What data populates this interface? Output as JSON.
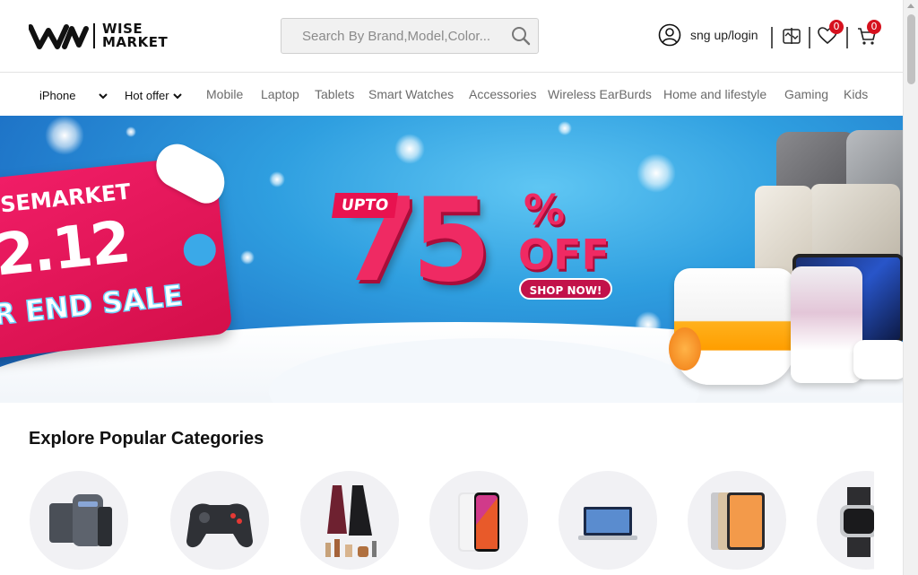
{
  "header": {
    "logo_text_line1": "WISE",
    "logo_text_line2": "MARKET",
    "search_placeholder": "Search By Brand,Model,Color...",
    "login_label": "sng up/login",
    "wishlist_count": "0",
    "cart_count": "0"
  },
  "nav": {
    "dropdowns": [
      {
        "label": "iPhone"
      },
      {
        "label": "Hot offer"
      }
    ],
    "links": [
      {
        "label": "Mobile"
      },
      {
        "label": "Laptop"
      },
      {
        "label": "Tablets"
      },
      {
        "label": "Smart Watches"
      },
      {
        "label": "Accessories"
      },
      {
        "label": "Wireless EarBurds"
      },
      {
        "label": "Home and lifestyle"
      },
      {
        "label": "Gaming"
      },
      {
        "label": "Kids"
      }
    ]
  },
  "banner": {
    "tag_line1": "SEMARKET",
    "tag_line2": "2.12",
    "tag_line3": "R END SALE",
    "upto": "UPTO",
    "discount": "75",
    "percent": "%",
    "off": "OFF",
    "cta": "SHOP NOW!"
  },
  "categories": {
    "title": "Explore Popular Categories",
    "items": [
      {
        "icon": "accessories-bundle-icon"
      },
      {
        "icon": "game-controller-icon"
      },
      {
        "icon": "fashion-beauty-icon"
      },
      {
        "icon": "smartphone-icon"
      },
      {
        "icon": "laptop-icon"
      },
      {
        "icon": "tablet-icon"
      },
      {
        "icon": "smartwatch-icon"
      }
    ]
  },
  "colors": {
    "brand_red": "#d6111e",
    "banner_pink": "#ef2a63",
    "banner_blue": "#2f9fe0"
  }
}
